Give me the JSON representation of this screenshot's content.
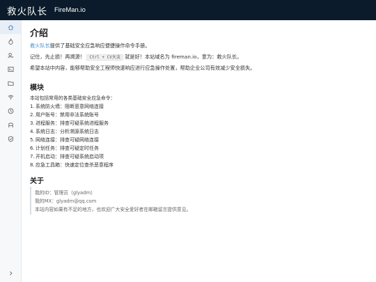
{
  "header": {
    "title_cn": "救火队长",
    "title_en": "FireMan.io"
  },
  "sidebar": {
    "items": [
      {
        "icon": "home-icon",
        "active": true
      },
      {
        "icon": "flame-icon"
      },
      {
        "icon": "user-search-icon"
      },
      {
        "icon": "terminal-icon"
      },
      {
        "icon": "folder-icon"
      },
      {
        "icon": "wifi-icon"
      },
      {
        "icon": "clock-icon"
      },
      {
        "icon": "toolbox-icon"
      },
      {
        "icon": "shield-icon"
      }
    ],
    "expand_icon": "chevron-right-icon"
  },
  "intro": {
    "title": "介绍",
    "p1_link": "救火队长",
    "p1_rest": "提供了基础安全应急响应便捷操作命令手册。",
    "p2_a": "记住，先止损！再溯源！",
    "p2_code": "Ctrl + CV大法",
    "p2_b": "就是好！本站域名为",
    "p2_domain": "fireman.io",
    "p2_c": "，意为：救火队长。",
    "p3": "希望本站中内容，能够帮助安全工程师快速响应进行应急操作处置，帮助企业公司有效减少安全损失。"
  },
  "modules": {
    "title": "模块",
    "desc": "本站包括常用的各类基础安全应急命令：",
    "items": [
      {
        "num": "1.",
        "text": "系统防火墙：阻断恶意网络连接"
      },
      {
        "num": "2.",
        "text": "用户账号：禁用非法系统账号"
      },
      {
        "num": "3.",
        "text": "进程服务：排查可疑系统进程服务"
      },
      {
        "num": "4.",
        "text": "系统日志：分析溯源系统日志"
      },
      {
        "num": "5.",
        "text": "网络连接：排查可疑网络连接"
      },
      {
        "num": "6.",
        "text": "计划任务：排查可疑定时任务"
      },
      {
        "num": "7.",
        "text": "开机启动：排查可疑系统启动项"
      },
      {
        "num": "8.",
        "text": "应急工具箱：快速定位查杀恶意程序"
      }
    ]
  },
  "about": {
    "title": "关于",
    "id_line": "我的ID：管理员（glyadm）",
    "mx_line": "我的MX：glyadm@qq.com",
    "note": "本站内容如果有不足的地方，也欢迎广大安全爱好者在邮箱留言提供意见。"
  }
}
